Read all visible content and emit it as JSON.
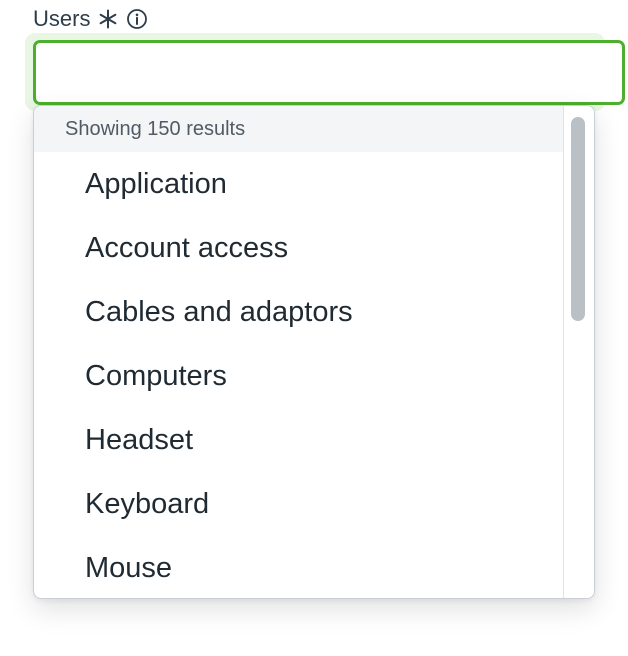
{
  "field": {
    "label": "Users",
    "required_icon": "asterisk-icon",
    "info_icon": "info-icon",
    "value": "",
    "placeholder": ""
  },
  "dropdown": {
    "results_text": "Showing 150 results",
    "options": [
      "Application",
      "Account access",
      "Cables and adaptors",
      "Computers",
      "Headset",
      "Keyboard",
      "Mouse"
    ]
  },
  "colors": {
    "focus_border": "#4caf2e",
    "focus_halo": "#e9f6e3",
    "text": "#2e3d49",
    "scrollbar_thumb": "#b9c0c6"
  }
}
